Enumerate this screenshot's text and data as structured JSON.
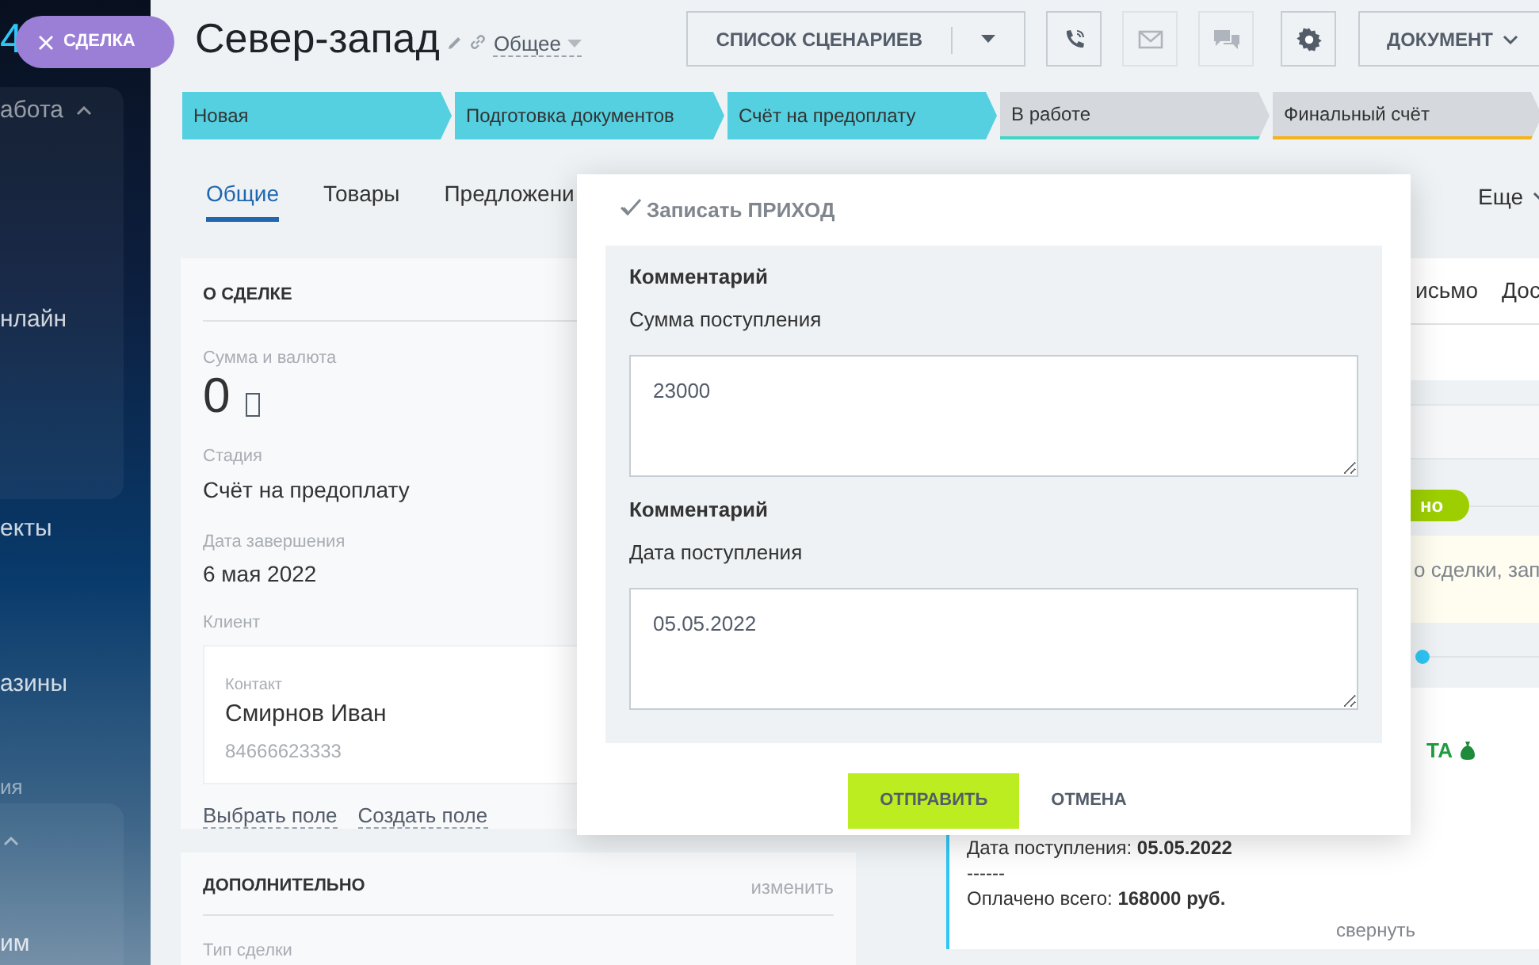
{
  "sidebar": {
    "logo_fragment": "4",
    "items": [
      {
        "kind": "group",
        "label": "абота",
        "expanded": true
      },
      {
        "kind": "item",
        "label": "нлайн",
        "expanded": false
      },
      {
        "kind": "item",
        "label": "екты",
        "expanded": false
      },
      {
        "kind": "item",
        "label": "азины",
        "expanded": false
      },
      {
        "kind": "heading",
        "label": "ия",
        "expanded": false
      },
      {
        "kind": "toggle",
        "expanded": true
      },
      {
        "kind": "item",
        "label": "им",
        "expanded": false
      }
    ]
  },
  "entity_pill": {
    "label": "СДЕЛКА"
  },
  "header": {
    "title": "Север-запад",
    "category": "Общее",
    "buttons": [
      {
        "kind": "split",
        "label": "СПИСОК СЦЕНАРИЕВ",
        "disabled": false
      },
      {
        "kind": "phone",
        "disabled": false
      },
      {
        "kind": "mail",
        "disabled": true
      },
      {
        "kind": "chat",
        "disabled": true
      },
      {
        "kind": "settings",
        "disabled": false
      },
      {
        "kind": "menu",
        "label": "ДОКУМЕНТ",
        "disabled": false
      }
    ]
  },
  "stages": [
    {
      "label": "Новая",
      "done": true,
      "color": "#55d0e0"
    },
    {
      "label": "Подготовка документов",
      "done": true,
      "color": "#55d0e0"
    },
    {
      "label": "Счёт на предоплату",
      "done": true,
      "color": "#55d0e0"
    },
    {
      "label": "В работе",
      "done": false,
      "color": "#3fd6c4"
    },
    {
      "label": "Финальный счёт",
      "done": false,
      "color": "#f4b21b"
    }
  ],
  "tabs": [
    {
      "label": "Общие",
      "selected": true
    },
    {
      "label": "Товары",
      "selected": false
    },
    {
      "label": "Предложени",
      "selected": false
    }
  ],
  "more": {
    "label": "Еще"
  },
  "deal_card": {
    "title": "О СДЕЛКЕ",
    "amount": {
      "label": "Сумма и валюта",
      "value": "0"
    },
    "fields": [
      {
        "label": "Стадия",
        "value": "Счёт на предоплату"
      },
      {
        "label": "Дата завершения",
        "value": "6 мая 2022"
      }
    ],
    "client": {
      "label": "Клиент",
      "type": "Контакт",
      "name": "Смирнов Иван",
      "phone": "84666623333"
    },
    "links": [
      "Выбрать поле",
      "Создать поле"
    ]
  },
  "extra_card": {
    "title": "ДОПОЛНИТЕЛЬНО",
    "action": "изменить",
    "fields": [
      {
        "label": "Тип сделки"
      }
    ]
  },
  "activity": {
    "tabs": [
      "исьмо",
      "Дос"
    ],
    "badge": "но",
    "note": "о сделки, зап",
    "entry": {
      "title": "ТА",
      "lines": [
        "Дата поступления: **05.05.2022**",
        "------",
        "Оплачено всего: **168000 руб.**"
      ],
      "collapse": "свернуть"
    }
  },
  "modal": {
    "title": "Записать ПРИХОД",
    "fields": [
      {
        "heading": "Комментарий",
        "label": "Сумма поступления",
        "value": "23000"
      },
      {
        "heading": "Комментарий",
        "label": "Дата поступления",
        "value": "05.05.2022"
      }
    ],
    "buttons": [
      {
        "kind": "primary",
        "label": "ОТПРАВИТЬ"
      },
      {
        "kind": "link",
        "label": "ОТМЕНА"
      }
    ]
  }
}
